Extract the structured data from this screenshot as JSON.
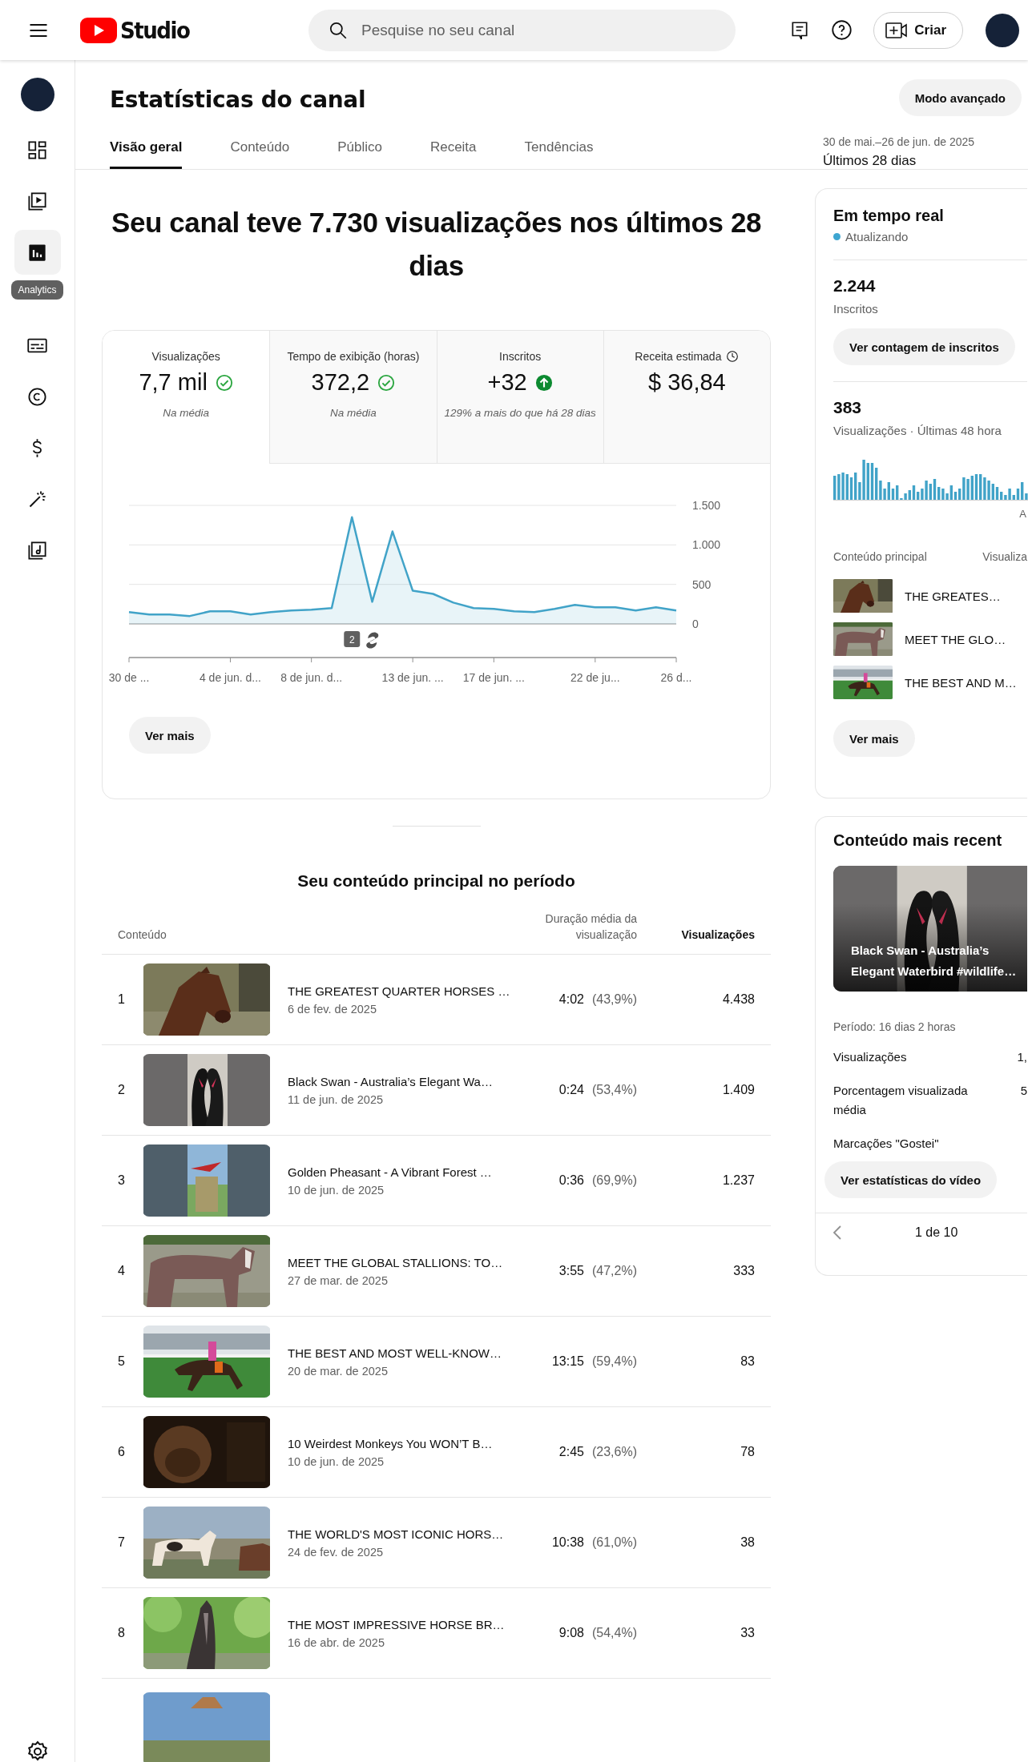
{
  "header": {
    "logo_text": "Studio",
    "search": {
      "placeholder": "Pesquise no seu canal"
    },
    "create_button": "Criar"
  },
  "sidebar": {
    "items": [
      {
        "kind": "dashboard",
        "selected": false
      },
      {
        "kind": "content",
        "selected": false
      },
      {
        "kind": "analytics",
        "selected": true,
        "tooltip": "Analytics"
      },
      {
        "kind": "subtitles",
        "selected": false
      },
      {
        "kind": "copyright",
        "selected": false
      },
      {
        "kind": "earn",
        "selected": false
      },
      {
        "kind": "customize",
        "selected": false
      },
      {
        "kind": "audio",
        "selected": false
      }
    ]
  },
  "page": {
    "title": "Estatísticas do canal",
    "advanced_button": "Modo avançado",
    "date_range": "30 de mai.–26 de jun. de 2025",
    "period": "Últimos 28 dias",
    "tabs": [
      {
        "label": "Visão geral",
        "selected": true
      },
      {
        "label": "Conteúdo",
        "selected": false
      },
      {
        "label": "Público",
        "selected": false
      },
      {
        "label": "Receita",
        "selected": false
      },
      {
        "label": "Tendências",
        "selected": false
      }
    ]
  },
  "overview": {
    "headline": "Seu canal teve 7.730 visualizações nos últimos 28 dias",
    "metrics": [
      {
        "label": "Visualizações",
        "value": "7,7 mil",
        "note": "Na média",
        "kind": "average",
        "selected": true
      },
      {
        "label": "Tempo de exibição (horas)",
        "value": "372,2",
        "note": "Na média",
        "kind": "average",
        "selected": false
      },
      {
        "label": "Inscritos",
        "value": "+32",
        "note": "129% a mais do que há 28 dias",
        "kind": "increase",
        "selected": false
      },
      {
        "label": "Receita estimada",
        "value": "$ 36,84",
        "kind": "estimate",
        "selected": false
      }
    ],
    "chart_data": {
      "type": "area",
      "categories": [
        "30 de ...",
        null,
        null,
        null,
        null,
        "4 de jun. d...",
        null,
        null,
        null,
        "8 de jun. d...",
        null,
        null,
        null,
        null,
        "13 de jun. ...",
        null,
        null,
        null,
        "17 de jun. ...",
        null,
        null,
        null,
        null,
        "22 de ju...",
        null,
        null,
        null,
        "26 d..."
      ],
      "series": [
        {
          "color": "#41a3c8",
          "values": [
            150,
            120,
            120,
            100,
            160,
            160,
            120,
            150,
            170,
            180,
            200,
            1350,
            280,
            1170,
            420,
            380,
            270,
            200,
            190,
            160,
            150,
            190,
            240,
            210,
            210,
            170,
            210,
            170
          ]
        }
      ],
      "ylim": [
        0,
        1500
      ],
      "yticks": [
        {
          "value": 0,
          "label": "0"
        },
        {
          "value": 500,
          "label": "500"
        },
        {
          "value": 1000,
          "label": "1.000"
        },
        {
          "value": 1500,
          "label": "1.500"
        }
      ]
    },
    "event_badge": "2",
    "more_button": "Ver mais"
  },
  "top_content": {
    "title": "Seu conteúdo principal no período",
    "columns": [
      {
        "label": "Conteúdo",
        "sorted": false
      },
      {
        "label": "Duração média da visualização",
        "sorted": false
      },
      {
        "label": "Visualizações",
        "sorted": true
      }
    ],
    "rows": [
      {
        "rank": "1",
        "title": "THE GREATEST QUARTER HORSES …",
        "date": "6 de fev. de 2025",
        "duration": "4:02",
        "percent": "(43,9%)",
        "views": "4.438",
        "thumbnail": {
          "kind": "picture"
        }
      },
      {
        "rank": "2",
        "title": "Black Swan - Australia’s Elegant Wa…",
        "date": "11 de jun. de 2025",
        "duration": "0:24",
        "percent": "(53,4%)",
        "views": "1.409",
        "thumbnail": {
          "kind": "picture"
        }
      },
      {
        "rank": "3",
        "title": "Golden Pheasant - A Vibrant Forest …",
        "date": "10 de jun. de 2025",
        "duration": "0:36",
        "percent": "(69,9%)",
        "views": "1.237",
        "thumbnail": {
          "kind": "picture"
        }
      },
      {
        "rank": "4",
        "title": "MEET THE GLOBAL STALLIONS: TO…",
        "date": "27 de mar. de 2025",
        "duration": "3:55",
        "percent": "(47,2%)",
        "views": "333",
        "thumbnail": {
          "kind": "picture"
        }
      },
      {
        "rank": "5",
        "title": "THE BEST AND MOST WELL-KNOW…",
        "date": "20 de mar. de 2025",
        "duration": "13:15",
        "percent": "(59,4%)",
        "views": "83",
        "thumbnail": {
          "kind": "picture"
        }
      },
      {
        "rank": "6",
        "title": "10 Weirdest Monkeys You WON’T B…",
        "date": "10 de jun. de 2025",
        "duration": "2:45",
        "percent": "(23,6%)",
        "views": "78",
        "thumbnail": {
          "kind": "picture"
        }
      },
      {
        "rank": "7",
        "title": "THE WORLD'S MOST ICONIC HORS…",
        "date": "24 de fev. de 2025",
        "duration": "10:38",
        "percent": "(61,0%)",
        "views": "38",
        "thumbnail": {
          "kind": "picture"
        }
      },
      {
        "rank": "8",
        "title": "THE MOST IMPRESSIVE HORSE BR…",
        "date": "16 de abr. de 2025",
        "duration": "9:08",
        "percent": "(54,4%)",
        "views": "33",
        "thumbnail": {
          "kind": "picture"
        }
      },
      {
        "thumbnail": {
          "kind": "picture"
        }
      }
    ]
  },
  "realtime": {
    "title": "Em tempo real",
    "status": "Atualizando",
    "subscribers": "2.244",
    "subscribers_label": "Inscritos",
    "subscribers_button": "Ver contagem de inscritos",
    "views": "383",
    "views_label": "Visualizações · Últimas 48 hora",
    "axis_label": "A",
    "columns": [
      "Conteúdo principal",
      "Visualiza"
    ],
    "items": [
      {
        "title": "THE GREATES…",
        "thumbnail": {
          "kind": "picture"
        }
      },
      {
        "title": "MEET THE GLO…",
        "thumbnail": {
          "kind": "picture"
        }
      },
      {
        "title": "THE BEST AND M…",
        "thumbnail": {
          "kind": "picture"
        }
      }
    ],
    "more_button": "Ver mais"
  },
  "recent": {
    "title": "Conteúdo mais recent",
    "video_title": "Black Swan - Australia’s Elegant Waterbird #wildlife…",
    "thumbnail": {
      "kind": "picture"
    },
    "period": "Período: 16 dias 2 horas",
    "stats": [
      {
        "label": "Visualizações",
        "value": "1,"
      },
      {
        "label": "Porcentagem visualizada média",
        "value": "5"
      },
      {
        "label": "Marcações \"Gostei\""
      }
    ],
    "button": "Ver estatísticas do vídeo",
    "pager": "1 de 10"
  }
}
